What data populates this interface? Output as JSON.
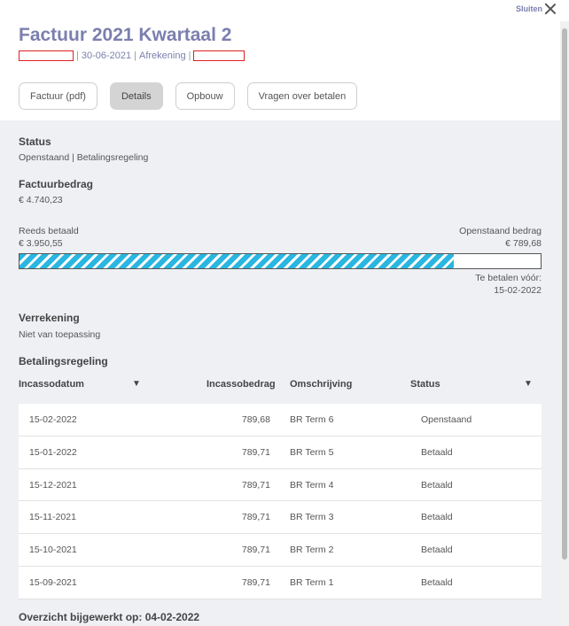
{
  "header": {
    "close_label": "Sluiten",
    "title": "Factuur 2021 Kwartaal 2",
    "meta_date": "30-06-2021",
    "meta_type": "Afrekening",
    "meta_sep": "|"
  },
  "tabs": [
    {
      "label": "Factuur (pdf)",
      "active": false
    },
    {
      "label": "Details",
      "active": true
    },
    {
      "label": "Opbouw",
      "active": false
    },
    {
      "label": "Vragen over betalen",
      "active": false
    }
  ],
  "status": {
    "title": "Status",
    "value": "Openstaand | Betalingsregeling"
  },
  "invoice_amount": {
    "title": "Factuurbedrag",
    "value": "€ 4.740,23"
  },
  "payment": {
    "paid_label": "Reeds betaald",
    "paid_value": "€ 3.950,55",
    "open_label": "Openstaand bedrag",
    "open_value": "€ 789,68",
    "progress_fraction": 0.8334,
    "due_label": "Te betalen vóór:",
    "due_value": "15-02-2022",
    "accent_color": "#29b6e0"
  },
  "settlement": {
    "title": "Verrekening",
    "value": "Niet van toepassing"
  },
  "arrangement": {
    "title": "Betalingsregeling",
    "columns": {
      "date": "Incassodatum",
      "amount": "Incassobedrag",
      "description": "Omschrijving",
      "status": "Status",
      "sort_icon": "▼"
    },
    "rows": [
      {
        "date": "15-02-2022",
        "amount": "789,68",
        "description": "BR Term 6",
        "status": "Openstaand"
      },
      {
        "date": "15-01-2022",
        "amount": "789,71",
        "description": "BR Term 5",
        "status": "Betaald"
      },
      {
        "date": "15-12-2021",
        "amount": "789,71",
        "description": "BR Term 4",
        "status": "Betaald"
      },
      {
        "date": "15-11-2021",
        "amount": "789,71",
        "description": "BR Term 3",
        "status": "Betaald"
      },
      {
        "date": "15-10-2021",
        "amount": "789,71",
        "description": "BR Term 2",
        "status": "Betaald"
      },
      {
        "date": "15-09-2021",
        "amount": "789,71",
        "description": "BR Term 1",
        "status": "Betaald"
      }
    ]
  },
  "footer": {
    "updated": "Overzicht bijgewerkt op: 04-02-2022"
  }
}
